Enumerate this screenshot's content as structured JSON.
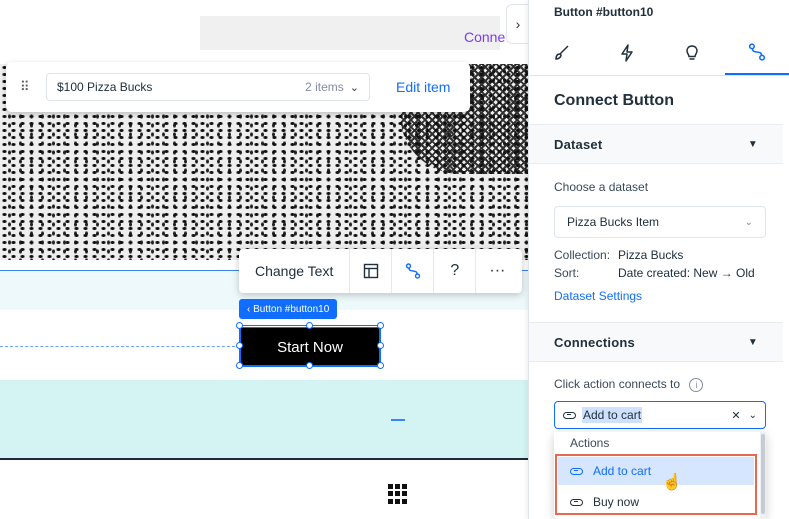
{
  "canvas": {
    "connect_peek": "Conne",
    "item_bar": {
      "item_name": "$100 Pizza Bucks",
      "item_count": "2 items",
      "edit_label": "Edit item"
    },
    "toolbar": {
      "change_text": "Change Text",
      "help": "?",
      "more": "···"
    },
    "button_tag": "‹ Button #button10",
    "button_label": "Start Now"
  },
  "panel": {
    "title": "Button #button10",
    "heading": "Connect Button",
    "dataset_section": "Dataset",
    "choose_label": "Choose a dataset",
    "dataset_value": "Pizza Bucks Item",
    "collection_key": "Collection:",
    "collection_value": "Pizza Bucks",
    "sort_key": "Sort:",
    "sort_value": "Date created: New → Old",
    "dataset_settings": "Dataset Settings",
    "connections_section": "Connections",
    "click_label": "Click action connects to",
    "action_value": "Add to cart",
    "dropdown": {
      "header": "Actions",
      "items": [
        "Add to cart",
        "Buy now"
      ]
    }
  },
  "colors": {
    "accent": "#116dff",
    "highlight": "#e8694f",
    "button_bg": "#000000"
  }
}
